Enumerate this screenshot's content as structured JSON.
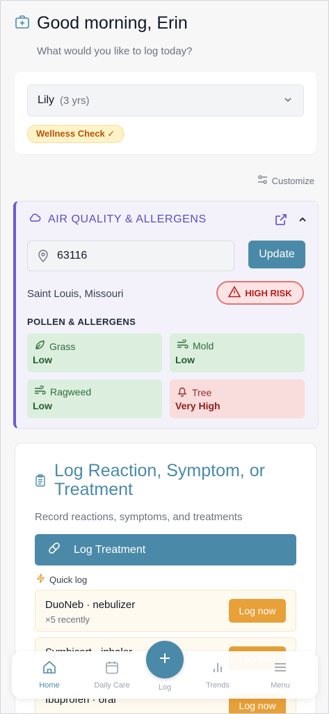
{
  "header": {
    "greeting": "Good morning, Erin",
    "subtitle": "What would you like to log today?"
  },
  "child_selector": {
    "name": "Lily",
    "age": "(3 yrs)",
    "badge": "Wellness Check ✓"
  },
  "customize_label": "Customize",
  "air_quality": {
    "title": "AIR QUALITY & ALLERGENS",
    "zip_value": "63116",
    "update_label": "Update",
    "location": "Saint Louis, Missouri",
    "risk_label": "HIGH RISK",
    "pollen_heading": "POLLEN & ALLERGENS",
    "allergens": [
      {
        "name": "Grass",
        "level": "Low",
        "icon": "leaf-icon",
        "status": "low"
      },
      {
        "name": "Mold",
        "level": "Low",
        "icon": "wind-icon",
        "status": "low"
      },
      {
        "name": "Ragweed",
        "level": "Low",
        "icon": "wind-icon",
        "status": "low"
      },
      {
        "name": "Tree",
        "level": "Very High",
        "icon": "bell-icon",
        "status": "high"
      }
    ],
    "colors": {
      "accent": "#5b4bc4",
      "low_bg": "#dcefdf",
      "high_bg": "#f9dcdc"
    }
  },
  "log_section": {
    "title": "Log Reaction, Symptom, or Treatment",
    "subtitle": "Record reactions, symptoms, and treatments",
    "log_button": "Log Treatment",
    "quick_log_label": "Quick log",
    "quick_items": [
      {
        "title": "DuoNeb · nebulizer",
        "sub": "×5 recently",
        "button": "Log now"
      },
      {
        "title": "Symbicort · inhaler",
        "sub": "",
        "button": "Log now"
      },
      {
        "title": "Ibuprofen · oral",
        "sub": "",
        "button": "Log now"
      }
    ]
  },
  "nav": {
    "home": "Home",
    "daily_care": "Daily Care",
    "log": "Log",
    "trends": "Trends",
    "menu": "Menu"
  },
  "colors": {
    "primary": "#4a8aa8",
    "quick_button": "#e8a038"
  }
}
